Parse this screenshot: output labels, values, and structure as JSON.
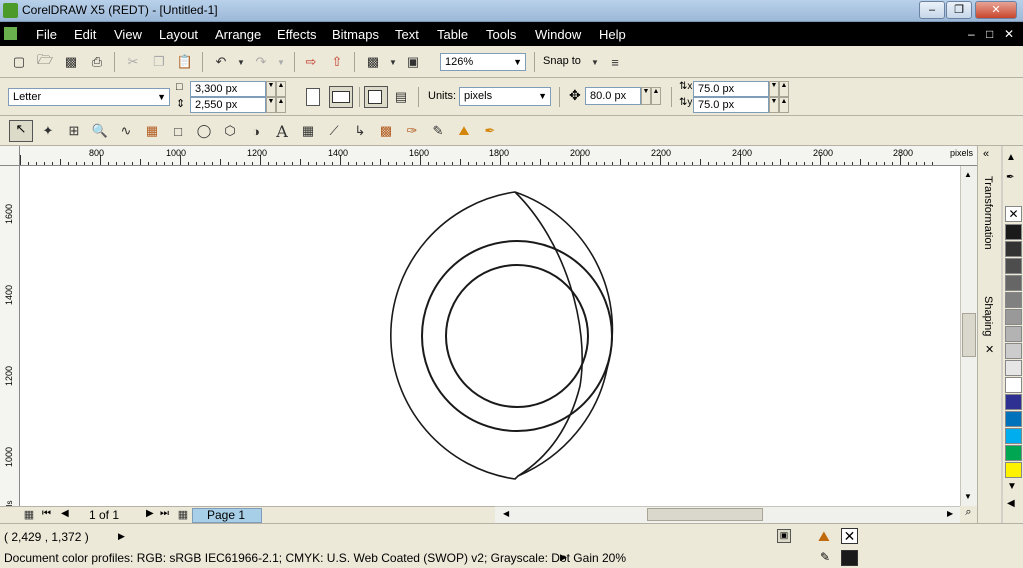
{
  "window": {
    "title": "CorelDRAW X5 (REDT) - [Untitled-1]",
    "min": "–",
    "restore": "❐",
    "close": "✕"
  },
  "menu": {
    "items": [
      "File",
      "Edit",
      "View",
      "Layout",
      "Arrange",
      "Effects",
      "Bitmaps",
      "Text",
      "Table",
      "Tools",
      "Window",
      "Help"
    ],
    "doc_controls": [
      "–",
      "□",
      "✕"
    ]
  },
  "toolbar": {
    "zoom": "126%",
    "snap_to": "Snap to"
  },
  "property_bar": {
    "page_size": "Letter",
    "width": "3,300 px",
    "height": "2,550 px",
    "units_label": "Units:",
    "units_value": "pixels",
    "nudge": "80.0 px",
    "dup_x": "75.0 px",
    "dup_y": "75.0 px"
  },
  "rulers": {
    "h_labels": [
      "800",
      "1000",
      "1200",
      "1400",
      "1600",
      "1800",
      "2000",
      "2200",
      "2400",
      "2600",
      "2800"
    ],
    "h_unit": "pixels",
    "v_labels": [
      "1600",
      "1400",
      "1200",
      "1000"
    ],
    "v_unit": "pixels"
  },
  "page_nav": {
    "counter": "1 of 1",
    "tab": "Page 1"
  },
  "dockers": {
    "transformation": "Transformation",
    "shaping": "Shaping"
  },
  "palette": {
    "colors": [
      "#1a1a1a",
      "#333333",
      "#4d4d4d",
      "#666666",
      "#808080",
      "#999999",
      "#b3b3b3",
      "#cccccc",
      "#e6e6e6",
      "#ffffff",
      "#2e3192",
      "#0072bc",
      "#00aeef",
      "#00a651",
      "#fff200"
    ]
  },
  "status": {
    "coords": "( 2,429 , 1,372 )",
    "profile": "Document color profiles: RGB: sRGB IEC61966-2.1; CMYK: U.S. Web Coated (SWOP) v2; Grayscale: Dot Gain 20%"
  },
  "colors": {
    "menubar": "#000000",
    "canvas": "#ffffff",
    "stroke": "#1a1a1a"
  }
}
